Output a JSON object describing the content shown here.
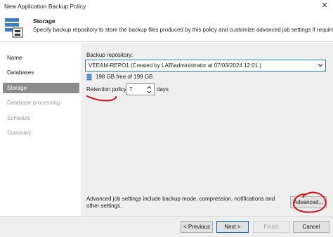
{
  "window": {
    "title": "New Application Backup Policy"
  },
  "header": {
    "title": "Storage",
    "description": "Specify backup repository to store the backup files produced by this policy and customize advanced job settings if required.",
    "icon": "storage-icon"
  },
  "sidebar": {
    "items": [
      {
        "label": "Name",
        "state": "normal"
      },
      {
        "label": "Databases",
        "state": "normal"
      },
      {
        "label": "Storage",
        "state": "active"
      },
      {
        "label": "Database processing",
        "state": "disabled"
      },
      {
        "label": "Schedule",
        "state": "disabled"
      },
      {
        "label": "Summary",
        "state": "disabled"
      }
    ]
  },
  "storage": {
    "repository_label": "Backup repository:",
    "repository_value": "VEEAM-REPO1 (Created by LAB\\administrator at 07/03/2024 12:01.)",
    "free_space": "198 GB free of 199 GB",
    "retention_label": "Retention policy:",
    "retention_value": "7",
    "retention_unit": "days",
    "advanced_text": "Advanced job settings include backup mode, compression, notifications and other settings.",
    "advanced_button": "Advanced..."
  },
  "footer": {
    "previous": "< Previous",
    "next": "Next >",
    "finish": "Finish",
    "cancel": "Cancel"
  },
  "colors": {
    "accent": "#2b78c5",
    "sidebar_active": "#8b8b8b",
    "annotation": "#d1141b"
  }
}
